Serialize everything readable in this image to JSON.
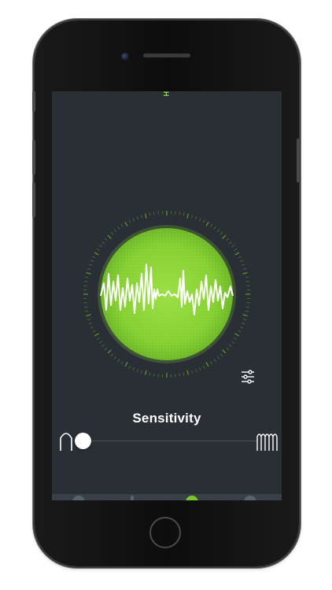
{
  "screen": {
    "top_indicator": "H",
    "sensitivity_label": "Sensitivity",
    "sensitivity_level": 0.0
  },
  "colors": {
    "accent_green": "#8fd63a",
    "screen_bg": "#2a2f36"
  },
  "icons": {
    "settings": "sliders-icon",
    "low": "low-sensitivity-icon",
    "high": "high-sensitivity-icon",
    "waveform": "waveform-icon"
  }
}
